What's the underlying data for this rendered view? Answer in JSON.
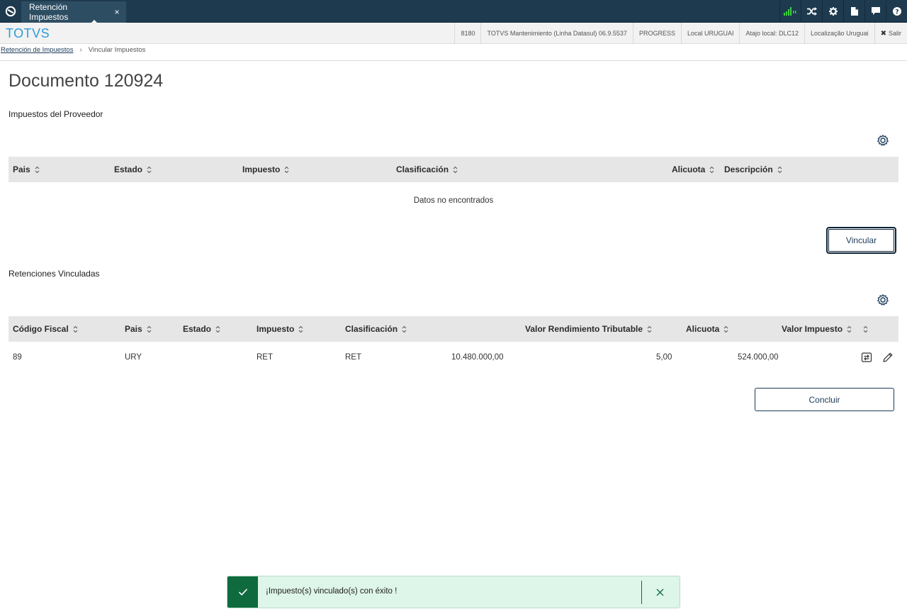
{
  "topbar": {
    "tab_label": "Retención Impuestos",
    "tab_close": "×",
    "icons": [
      "totvs-logo-icon",
      "signal-icon",
      "shuffle-icon",
      "gear-icon",
      "document-icon",
      "chat-icon",
      "help-icon"
    ]
  },
  "infobar": {
    "brand": "TOTVS",
    "items": [
      "8180",
      "TOTVS Mantenimiento (Linha Datasul) 06.9.5537",
      "PROGRESS",
      "Local URUGUAI",
      "Atajo local: DLC12",
      "Localização Uruguai"
    ],
    "exit_label": "Salir"
  },
  "breadcrumb": {
    "link": "Retención de Impuestos",
    "current": "Vincular Impuestos"
  },
  "page": {
    "title": "Documento 120924"
  },
  "proveedor": {
    "section_title": "Impuestos del Proveedor",
    "columns": [
      "Pais",
      "Estado",
      "Impuesto",
      "Clasificación",
      "Alicuota",
      "Descripción"
    ],
    "empty_message": "Datos no encontrados",
    "button_label": "Vincular"
  },
  "retenciones": {
    "section_title": "Retenciones Vinculadas",
    "columns": [
      "Código Fiscal",
      "Pais",
      "Estado",
      "Impuesto",
      "Clasificación",
      "Valor Rendimiento Tributable",
      "Alicuota",
      "Valor Impuesto"
    ],
    "rows": [
      {
        "codigo_fiscal": "89",
        "pais": "URY",
        "estado": "",
        "impuesto": "RET",
        "clasificacion": "RET",
        "valor_rendimiento": "10.480.000,00",
        "alicuota": "5,00",
        "valor_impuesto": "524.000,00"
      }
    ],
    "button_label": "Concluir"
  },
  "toast": {
    "message": "¡Impuesto(s) vinculado(s) con éxito !",
    "status_color": "#0f6b3e"
  },
  "colors": {
    "topbar": "#1e3a4f",
    "brand": "#2d9cdb",
    "table_header": "#e6e6e6",
    "toast_bg": "#def5ea"
  }
}
